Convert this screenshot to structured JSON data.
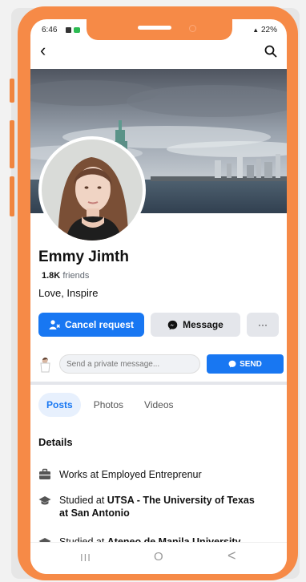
{
  "status_bar": {
    "time": "6:46",
    "battery": "22%"
  },
  "profile": {
    "name": "Emmy Jimth",
    "friends_count": "1.8K",
    "friends_label": "friends",
    "bio": "Love, Inspire"
  },
  "actions": {
    "cancel_request": "Cancel request",
    "message": "Message",
    "more": "···"
  },
  "private_message": {
    "placeholder": "Send a private message...",
    "send": "SEND"
  },
  "tabs": [
    "Posts",
    "Photos",
    "Videos"
  ],
  "details": {
    "title": "Details",
    "items": [
      {
        "icon": "briefcase-icon",
        "prefix": "Works at ",
        "bold": "",
        "plain": "Employed Entreprenur"
      },
      {
        "icon": "graduation-cap-icon",
        "prefix": "Studied at ",
        "bold": "UTSA - The University of Texas at San Antonio",
        "plain": ""
      },
      {
        "icon": "graduation-cap-icon",
        "prefix": "Studied at ",
        "bold": "Ateneo de Manila University",
        "plain": ""
      }
    ]
  },
  "nav": {
    "recent": "III",
    "home": "O",
    "back": "<"
  },
  "colors": {
    "accent": "#1877f2",
    "frame": "#f68a47"
  }
}
